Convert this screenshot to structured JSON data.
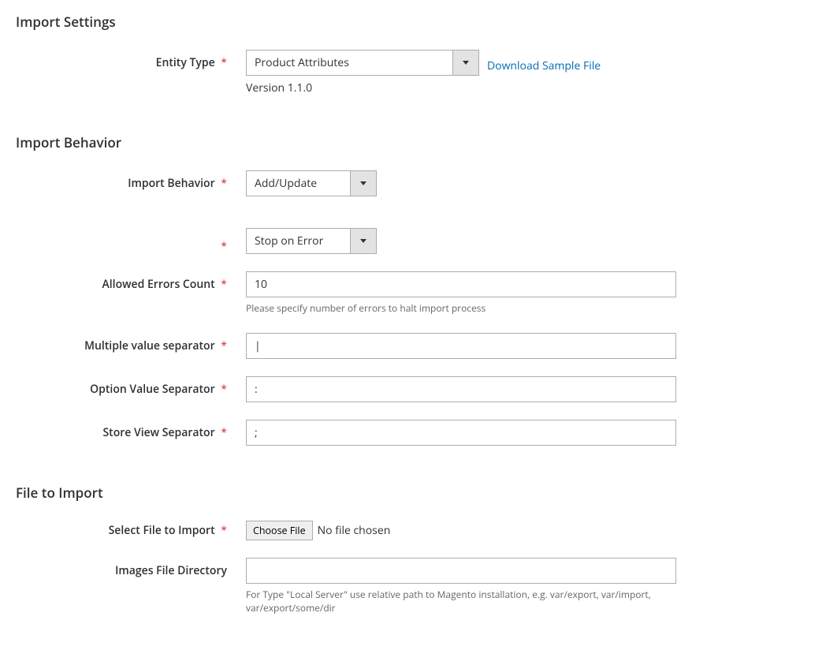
{
  "sections": {
    "import_settings": {
      "title": "Import Settings"
    },
    "import_behavior": {
      "title": "Import Behavior"
    },
    "file_to_import": {
      "title": "File to Import"
    }
  },
  "entity_type": {
    "label": "Entity Type",
    "value": "Product Attributes",
    "download_link": "Download Sample File",
    "version_text": "Version 1.1.0"
  },
  "behavior": {
    "label": "Import Behavior",
    "value": "Add/Update",
    "validation_value": "Stop on Error"
  },
  "allowed_errors": {
    "label": "Allowed Errors Count",
    "value": "10",
    "note": "Please specify number of errors to halt import process"
  },
  "multi_sep": {
    "label": "Multiple value separator",
    "value": "|"
  },
  "option_sep": {
    "label": "Option Value Separator",
    "value": ":"
  },
  "store_sep": {
    "label": "Store View Separator",
    "value": ";"
  },
  "file_select": {
    "label": "Select File to Import",
    "button": "Choose File",
    "status": "No file chosen"
  },
  "images_dir": {
    "label": "Images File Directory",
    "value": "",
    "note": "For Type \"Local Server\" use relative path to Magento installation, e.g. var/export, var/import, var/export/some/dir"
  },
  "asterisk": "*"
}
